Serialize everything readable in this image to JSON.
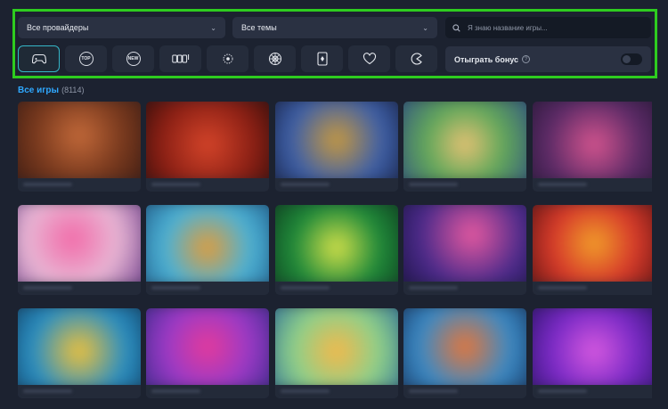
{
  "filters": {
    "providers_label": "Все провайдеры",
    "themes_label": "Все темы",
    "search_placeholder": "Я знаю название игры...",
    "bonus_label": "Отыграть бонус",
    "bonus_help": "?",
    "categories": [
      {
        "name": "all-games",
        "icon": "gamepad-icon",
        "active": true
      },
      {
        "name": "top",
        "icon": "top-badge-icon",
        "text": "TOP"
      },
      {
        "name": "new",
        "icon": "new-badge-icon",
        "text": "NEW"
      },
      {
        "name": "slots",
        "icon": "slot-machine-icon"
      },
      {
        "name": "live",
        "icon": "live-dot-icon"
      },
      {
        "name": "roulette",
        "icon": "roulette-icon"
      },
      {
        "name": "cards",
        "icon": "playing-card-icon"
      },
      {
        "name": "favorites",
        "icon": "heart-icon"
      },
      {
        "name": "arcade",
        "icon": "pacman-icon"
      }
    ]
  },
  "section": {
    "title": "Все игры",
    "count": "(8114)"
  },
  "colors": {
    "background": "#1c2230",
    "panel_outline": "#2ecc1f",
    "accent_link": "#2fa8ff",
    "active_border": "#35b6c8"
  }
}
